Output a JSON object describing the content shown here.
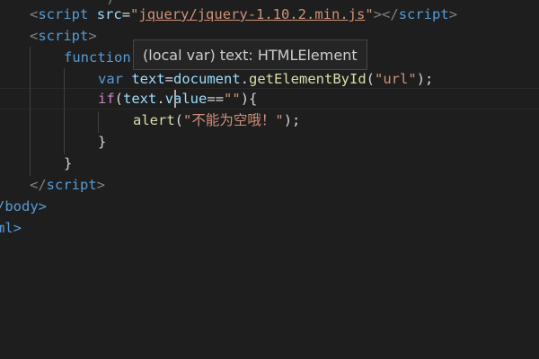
{
  "editor": {
    "lines": {
      "l1": {
        "open": "<",
        "tag": "script",
        "attr": "src",
        "eq": "=",
        "q1": "\"",
        "src": "jquery/jquery-1.10.2.min.js",
        "q2": "\"",
        "close": "></",
        "tag2": "script",
        "end": ">"
      },
      "l2": {
        "open": "<",
        "tag": "script",
        "end": ">"
      },
      "l3": {
        "kw": "function"
      },
      "l4": {
        "kw": "var",
        "name": "text",
        "eq": "=",
        "obj": "document",
        "dot": ".",
        "fn": "getElementById",
        "lp": "(",
        "arg": "\"url\"",
        "rp": ");"
      },
      "l5": {
        "kw": "if",
        "lp": "(",
        "obj": "text",
        "dot": ".",
        "prop": "value",
        "op": "==",
        "arg": "\"\"",
        "rp": "){"
      },
      "l6": {
        "fn": "alert",
        "lp": "(",
        "arg": "\"不能为空哦！\"",
        "rp": ");"
      },
      "l7": {
        "brace": "}"
      },
      "l8": {
        "brace": "}"
      },
      "l9": {
        "open": "</",
        "tag": "script",
        "end": ">"
      },
      "l10": {
        "text": "/body>"
      },
      "l11": {
        "text": "ml>"
      }
    },
    "hover": {
      "text": "(local var) text: HTMLElement"
    }
  }
}
